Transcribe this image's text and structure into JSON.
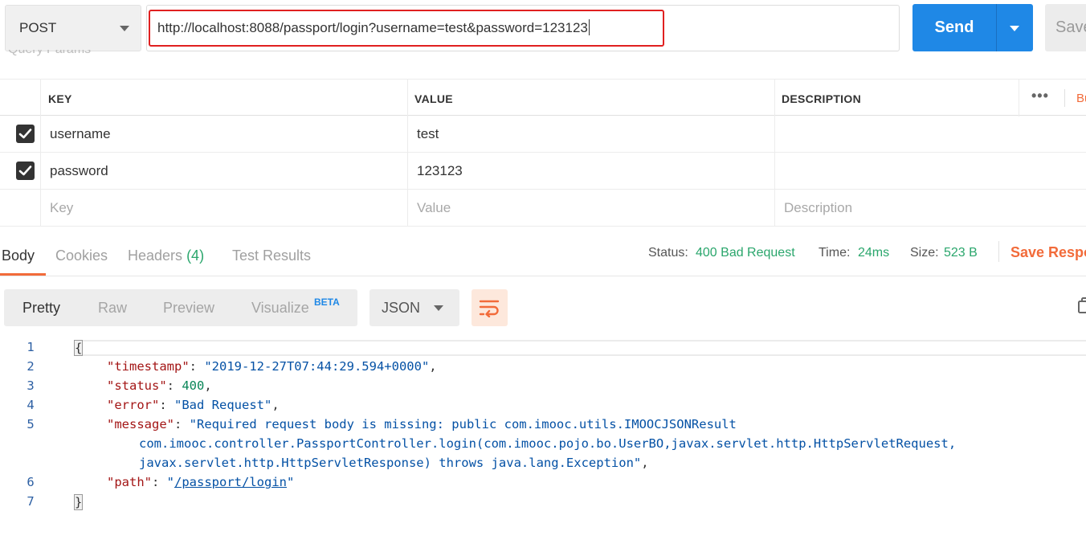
{
  "request": {
    "method": "POST",
    "url": "http://localhost:8088/passport/login?username=test&password=123123",
    "send_label": "Send",
    "save_label": "Save",
    "section_label": "Query Params"
  },
  "params_table": {
    "columns": [
      "KEY",
      "VALUE",
      "DESCRIPTION"
    ],
    "more_label": "•••",
    "bulk_edit_label": "Bulk Edit",
    "rows": [
      {
        "checked": true,
        "key": "username",
        "value": "test",
        "description": ""
      },
      {
        "checked": true,
        "key": "password",
        "value": "123123",
        "description": ""
      }
    ],
    "placeholders": {
      "key": "Key",
      "value": "Value",
      "description": "Description"
    }
  },
  "response": {
    "tabs": [
      {
        "label": "Body",
        "active": true
      },
      {
        "label": "Cookies"
      },
      {
        "label": "Headers",
        "count": "(4)"
      },
      {
        "label": "Test Results"
      }
    ],
    "status_label": "Status:",
    "status_value": "400 Bad Request",
    "time_label": "Time:",
    "time_value": "24ms",
    "size_label": "Size:",
    "size_value": "523 B",
    "save_response_label": "Save Response"
  },
  "body_toolbar": {
    "views": [
      "Pretty",
      "Raw",
      "Preview",
      "Visualize"
    ],
    "active_view": "Pretty",
    "beta_badge": "BETA",
    "format": "JSON"
  },
  "code": {
    "line_numbers": [
      "1",
      "2",
      "3",
      "4",
      "5",
      "",
      "",
      "6",
      "7"
    ],
    "open_brace": "{",
    "close_brace": "}",
    "timestamp_key": "\"timestamp\"",
    "timestamp_val": "\"2019-12-27T07:44:29.594+0000\"",
    "status_key": "\"status\"",
    "status_val": "400",
    "error_key": "\"error\"",
    "error_val": "\"Bad Request\"",
    "message_key": "\"message\"",
    "message_val_1": "\"Required request body is missing: public com.imooc.utils.IMOOCJSONResult",
    "message_val_2": "com.imooc.controller.PassportController.login(com.imooc.pojo.bo.UserBO,javax.servlet.http.HttpServletRequest,",
    "message_val_3": "javax.servlet.http.HttpServletResponse) throws java.lang.Exception\"",
    "path_key": "\"path\"",
    "path_quote": "\"",
    "path_val": "/passport/login"
  },
  "colors": {
    "send": "#1f88e6",
    "accent_orange": "#f26b3a",
    "status_green": "#2aa66c",
    "url_highlight": "#e02020"
  }
}
